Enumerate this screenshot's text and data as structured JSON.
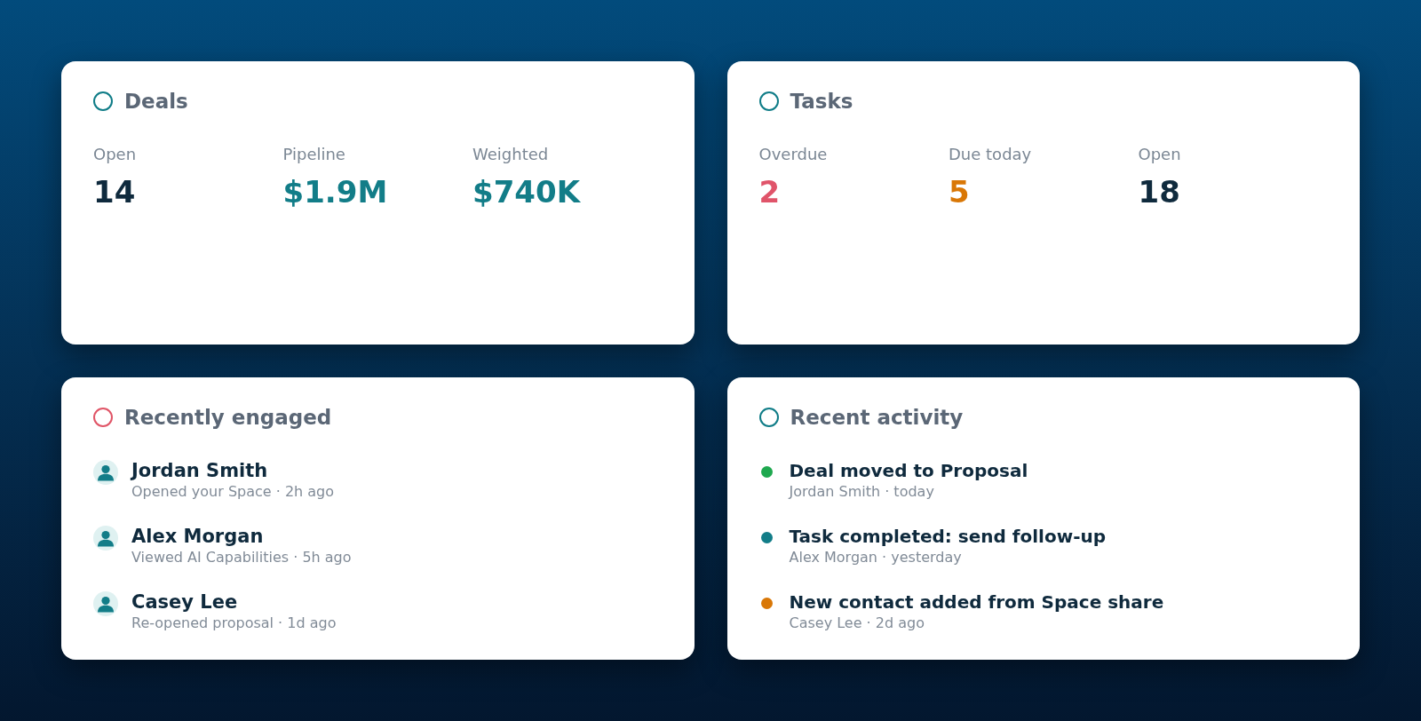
{
  "cards": [
    {
      "kind": "stats",
      "title": "Deals",
      "color": "#0f7c87",
      "stats": [
        {
          "label": "Open",
          "value": "14",
          "color": "#0f2a3d"
        },
        {
          "label": "Pipeline",
          "value": "$1.9M",
          "color": "#127d88"
        },
        {
          "label": "Weighted",
          "value": "$740K",
          "color": "#127d88"
        }
      ]
    },
    {
      "kind": "stats",
      "title": "Tasks",
      "color": "#0f7c87",
      "stats": [
        {
          "label": "Overdue",
          "value": "2",
          "color": "#e0546a"
        },
        {
          "label": "Due today",
          "value": "5",
          "color": "#d97706"
        },
        {
          "label": "Open",
          "value": "18",
          "color": "#0f2a3d"
        }
      ]
    },
    {
      "kind": "people",
      "title": "Recently engaged",
      "color": "#e05567",
      "items": [
        {
          "name": "Jordan Smith",
          "detail": "Opened your Space · 2h ago"
        },
        {
          "name": "Alex Morgan",
          "detail": "Viewed AI Capabilities · 5h ago"
        },
        {
          "name": "Casey Lee",
          "detail": "Re-opened proposal · 1d ago"
        }
      ]
    },
    {
      "kind": "activity",
      "title": "Recent activity",
      "color": "#0f7c87",
      "items": [
        {
          "title": "Deal moved to Proposal",
          "detail": "Jordan Smith · today",
          "color": "#1fa84f"
        },
        {
          "title": "Task completed: send follow-up",
          "detail": "Alex Morgan · yesterday",
          "color": "#127d88"
        },
        {
          "title": "New contact added from Space share",
          "detail": "Casey Lee · 2d ago",
          "color": "#d97706"
        }
      ]
    }
  ]
}
